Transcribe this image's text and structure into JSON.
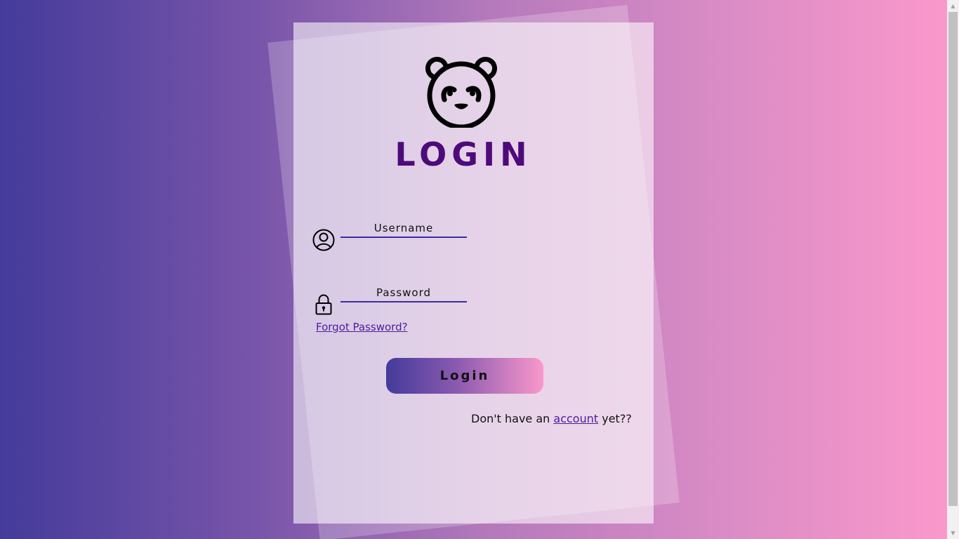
{
  "login": {
    "logo_icon": "panda-icon",
    "title": "LOGIN",
    "username": {
      "icon": "user-circle-icon",
      "placeholder": "Username",
      "value": ""
    },
    "password": {
      "icon": "lock-icon",
      "placeholder": "Password",
      "value": ""
    },
    "forgot_password": "Forgot Password?",
    "submit_label": "Login",
    "signup": {
      "prefix": "Don't have an",
      "link": "account",
      "suffix": "yet??"
    }
  },
  "colors": {
    "gradient_start": "#443b9b",
    "gradient_end": "#fa98cb",
    "title": "#4e0a7a",
    "link": "#4e1c9e"
  },
  "scrollbar": {
    "up_icon": "scroll-up-arrow-icon",
    "down_icon": "scroll-down-arrow-icon"
  }
}
